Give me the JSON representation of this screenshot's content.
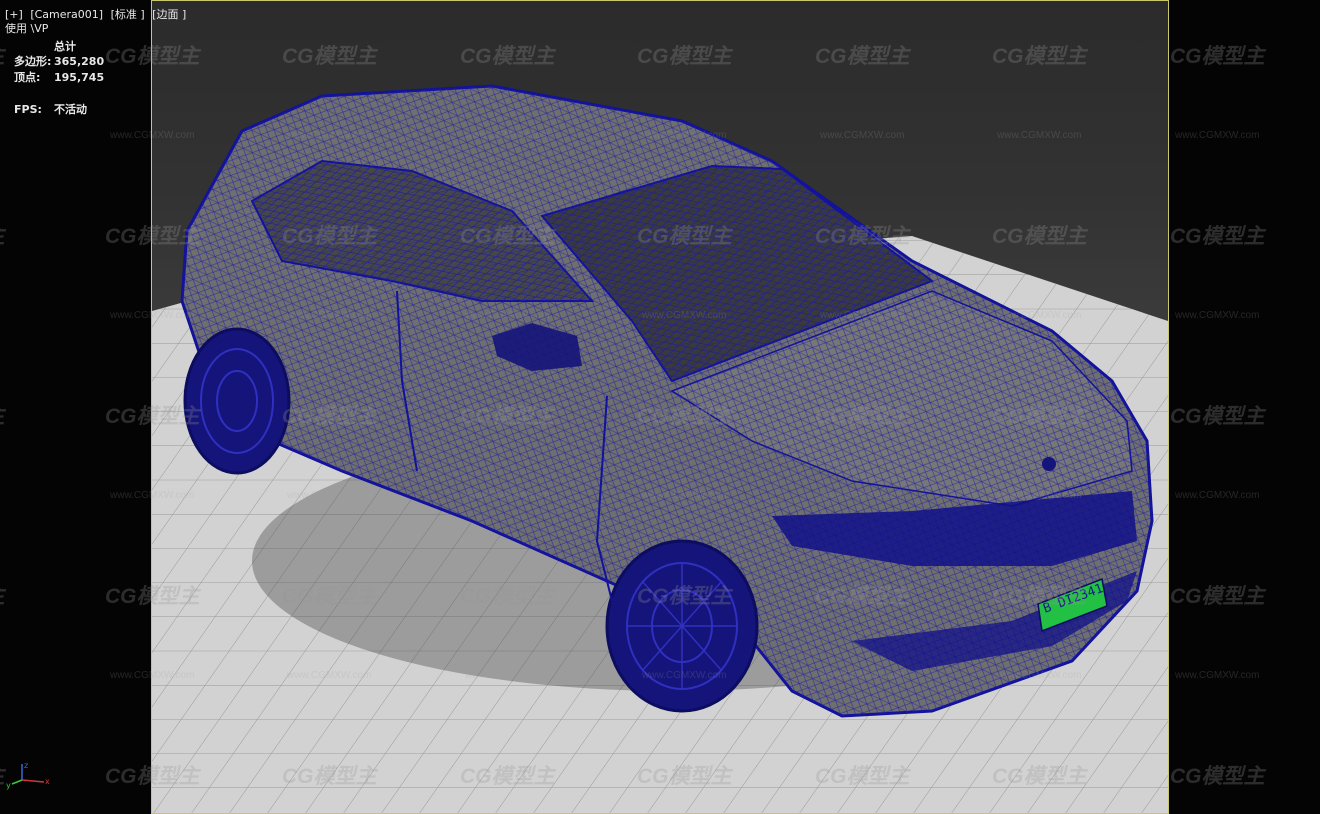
{
  "viewport": {
    "label_plus": "[+]",
    "label_camera": "[Camera001]",
    "label_shading": "[标准 ]",
    "label_display": "[边面 ]",
    "line2": "使用 \\VP"
  },
  "stats": {
    "header": "总计",
    "polygons_label": "多边形:",
    "polygons_value": "365,280",
    "vertices_label": "顶点:",
    "vertices_value": "195,745",
    "fps_label": "FPS:",
    "fps_value": "不活动"
  },
  "model": {
    "license_plate": "B DI2341",
    "wire_color": "#1a1aa8",
    "plate_color": "#22c043"
  },
  "watermark": {
    "brand": "CG模型主",
    "url": "www.CGMXW.com"
  },
  "axis": {
    "x": "x",
    "y": "y",
    "z": "z"
  }
}
